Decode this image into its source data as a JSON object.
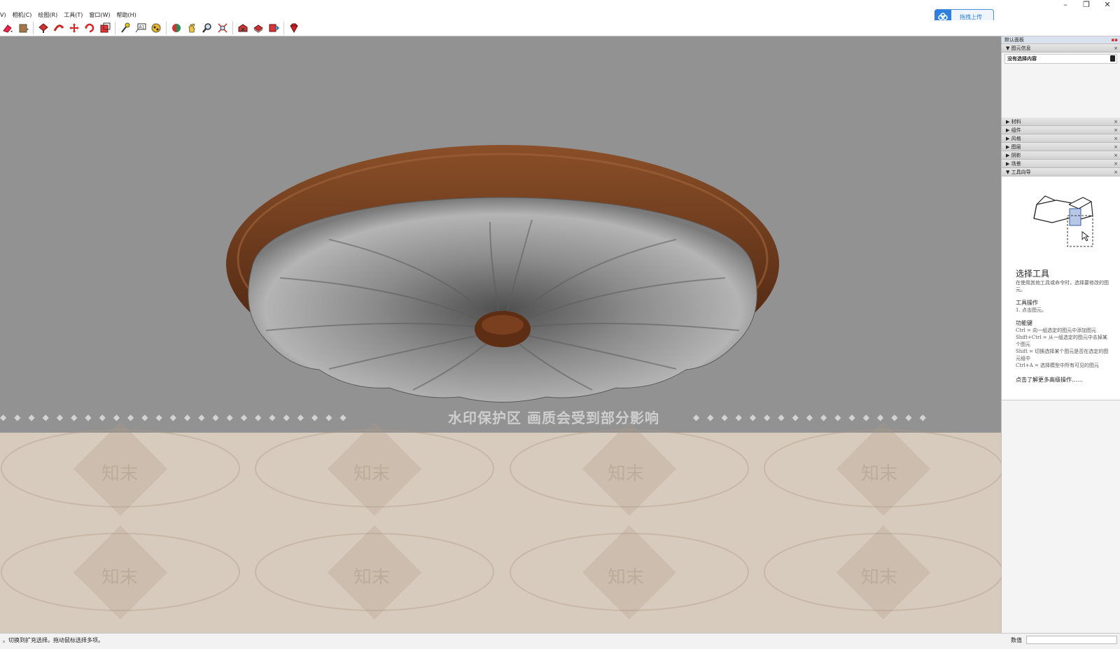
{
  "window": {
    "controls": {
      "minimize": "–",
      "restore": "❐",
      "close": "✕"
    }
  },
  "menu": [
    "V)",
    "相机(C)",
    "绘图(R)",
    "工具(T)",
    "窗口(W)",
    "帮助(H)"
  ],
  "upload_button": {
    "label": "拖拽上传"
  },
  "toolbar": {
    "tools": [
      "eraser-icon",
      "paint-bucket-icon",
      "push-pull-icon",
      "follow-me-icon",
      "move-icon",
      "rotate-icon",
      "scale-icon",
      "tape-measure-icon",
      "text-icon",
      "paint-icon",
      "orbit-icon",
      "pan-icon",
      "zoom-icon",
      "zoom-extents-icon",
      "warehouse-icon",
      "extension-icon",
      "share-model-icon",
      "ruby-icon"
    ]
  },
  "viewport": {
    "watermark_text": "水印保护区   画质会受到部分影响",
    "watermark_mark": "知末",
    "colors": {
      "background": "#929292",
      "lower": "#d7cbbd",
      "wood": "#6b3a1d",
      "fabric": "#8c8c8c"
    }
  },
  "panel": {
    "title": "默认面板",
    "entity_info": {
      "label": "图元信息",
      "selection": "没有选择内容"
    },
    "sections": [
      "材料",
      "组件",
      "风格",
      "图层",
      "阴影",
      "场景"
    ],
    "instructor": {
      "label": "工具向导",
      "tool_title": "选择工具",
      "description": "在使用其他工具或命令时，选择要修改的图元。",
      "operations_heading": "工具操作",
      "operations": [
        "1. 点击图元。"
      ],
      "keys_heading": "功能键",
      "keys": [
        "Ctrl = 向一组选定的图元中添加图元",
        "Shift+Ctrl = 从一组选定的图元中去掉某个图元",
        "Shift = 切换选择某个图元是否在选定的图元组中",
        "Ctrl+A = 选择模型中所有可见的图元"
      ],
      "more_link": "点击了解更多高级操作……"
    }
  },
  "status": {
    "text": "。切换到扩充选择。拖动鼠标选择多项。",
    "measure_label": "数值",
    "measure_value": ""
  }
}
